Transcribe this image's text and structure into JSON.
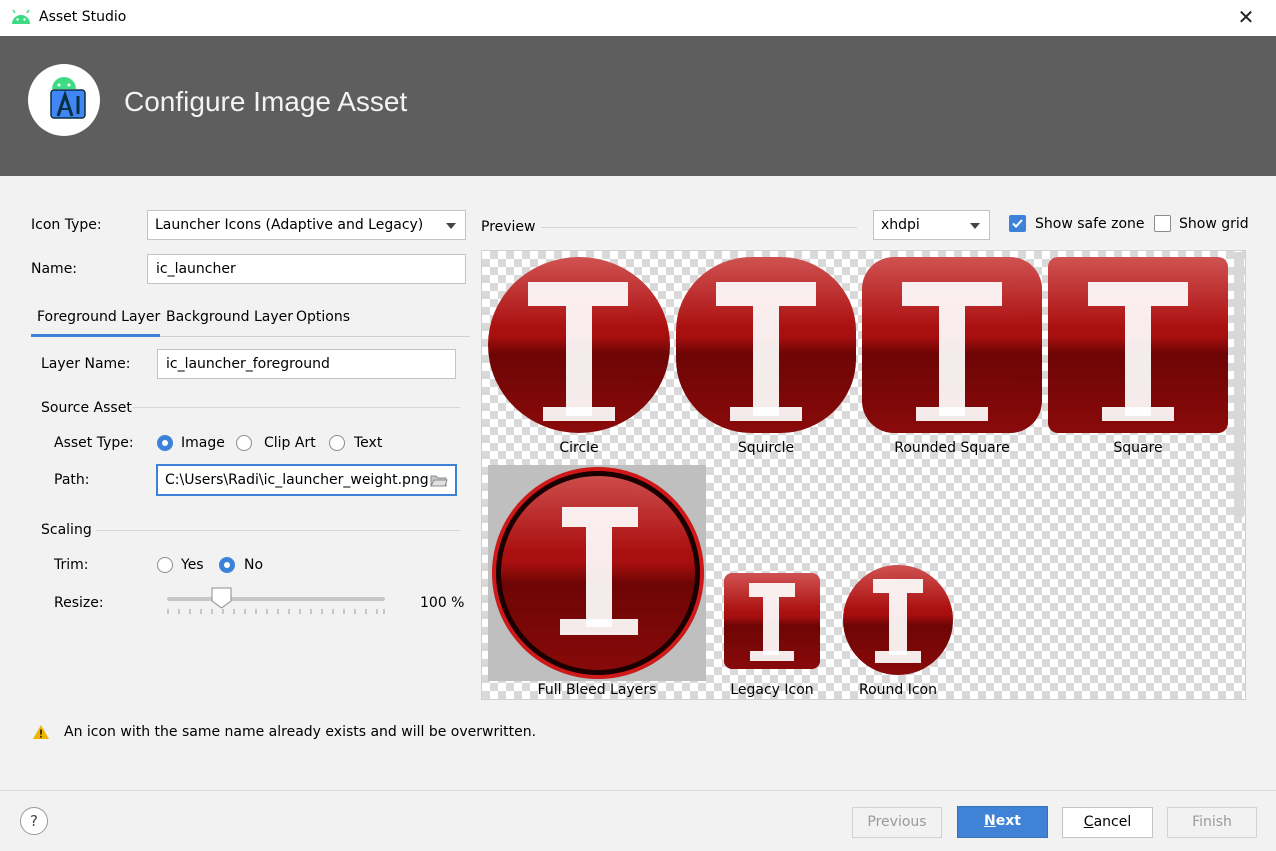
{
  "window": {
    "title": "Asset Studio"
  },
  "header": {
    "title": "Configure Image Asset"
  },
  "form": {
    "icon_type_label": "Icon Type:",
    "icon_type_value": "Launcher Icons (Adaptive and Legacy)",
    "name_label": "Name:",
    "name_value": "ic_launcher"
  },
  "tabs": [
    {
      "label": "Foreground Layer",
      "selected": true
    },
    {
      "label": "Background Layer",
      "selected": false
    },
    {
      "label": "Options",
      "selected": false
    }
  ],
  "layer": {
    "layer_name_label": "Layer Name:",
    "layer_name_value": "ic_launcher_foreground",
    "source_asset_heading": "Source Asset",
    "asset_type_label": "Asset Type:",
    "asset_types": [
      {
        "label": "Image",
        "selected": true
      },
      {
        "label": "Clip Art",
        "selected": false
      },
      {
        "label": "Text",
        "selected": false
      }
    ],
    "path_label": "Path:",
    "path_value": "C:\\Users\\Radi\\ic_launcher_weight.png",
    "scaling_heading": "Scaling",
    "trim_label": "Trim:",
    "trim_options": [
      {
        "label": "Yes",
        "selected": false
      },
      {
        "label": "No",
        "selected": true
      }
    ],
    "resize_label": "Resize:",
    "resize_value_text": "100 %",
    "resize_fraction": 0.25
  },
  "preview": {
    "label": "Preview",
    "density": "xhdpi",
    "show_safe_zone_label": "Show safe zone",
    "show_safe_zone_checked": true,
    "show_grid_label": "Show grid",
    "show_grid_checked": false,
    "captions": {
      "circle": "Circle",
      "squircle": "Squircle",
      "rounded_square": "Rounded Square",
      "square": "Square",
      "full_bleed": "Full Bleed Layers",
      "legacy": "Legacy Icon",
      "round": "Round Icon"
    }
  },
  "warning": {
    "text": "An icon with the same name already exists and will be overwritten."
  },
  "buttons": {
    "help": "?",
    "previous": "Previous",
    "next_pre": "",
    "next_mnemonic": "N",
    "next_post": "ext",
    "cancel_mnemonic": "C",
    "cancel_post": "ancel",
    "finish": "Finish"
  },
  "colors": {
    "accent": "#3d82d9",
    "header_bg": "#5e5e5e",
    "icon_red": "#a80f0f",
    "warning": "#f0b400"
  }
}
